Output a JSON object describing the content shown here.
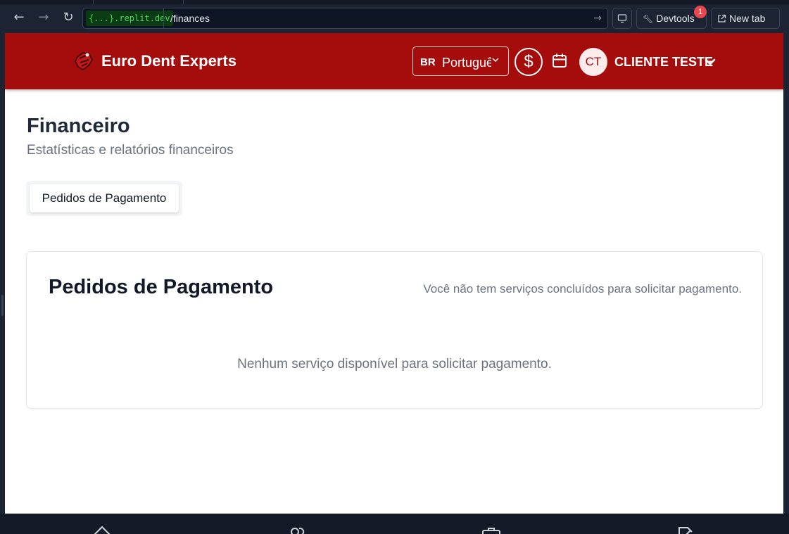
{
  "browser": {
    "url_domain_badge": "{...}",
    "url_domain_rest": ".replit.dev",
    "url_path": "/finances",
    "devtools_label": "Devtools",
    "devtools_badge": "1",
    "newtab_label": "New tab"
  },
  "header": {
    "brand": "Euro Dent Experts",
    "language_flag": "BR",
    "language_value": "Português",
    "currency_symbol": "$",
    "avatar_initials": "CT",
    "user_name": "CLIENTE TESTE",
    "accent_color": "#a50d0d"
  },
  "page": {
    "title": "Financeiro",
    "subtitle": "Estatísticas e relatórios financeiros",
    "tabs": [
      {
        "label": "Pedidos de Pagamento",
        "active": true
      }
    ]
  },
  "card": {
    "title": "Pedidos de Pagamento",
    "description": "Você não tem serviços concluídos para solicitar pagamento.",
    "empty_message": "Nenhum serviço disponível para solicitar pagamento."
  },
  "bottom_nav": {
    "icons": [
      "home-icon",
      "users-icon",
      "briefcase-icon",
      "file-edit-icon"
    ]
  }
}
